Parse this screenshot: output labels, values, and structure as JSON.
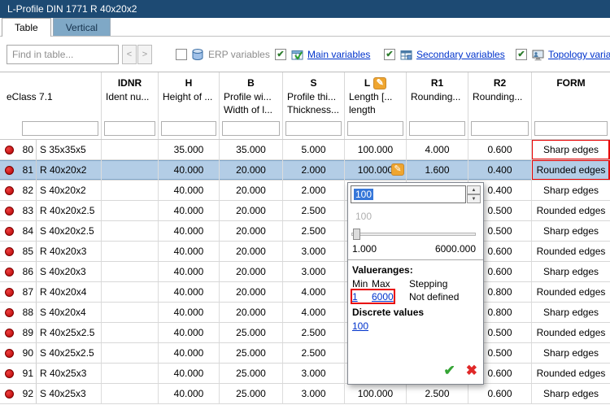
{
  "colors": {
    "titlebar": "#1d4a73",
    "selected_row": "#b3cde6",
    "link": "#0033cc",
    "status_dot": "#c41414",
    "annotation": "#e80000",
    "pencil_button": "#efa52f"
  },
  "icons": {
    "check": "✔",
    "pencil": "✎",
    "confirm": "✔",
    "cancel": "✖",
    "spinner_up": "▲",
    "spinner_down": "▼",
    "find_prev": "<",
    "find_next": ">"
  },
  "window": {
    "title": "L-Profile DIN 1771 R 40x20x2"
  },
  "tabs": {
    "table": "Table",
    "vertical": "Vertical"
  },
  "toolbar": {
    "find_placeholder": "Find in table...",
    "erp_label": "ERP variables",
    "main_label": "Main variables",
    "secondary_label": "Secondary variables",
    "topology_label": "Topology varia"
  },
  "table": {
    "eclass": "eClass 7.1",
    "columns": [
      {
        "code": "IDNR",
        "desc1": "Ident nu...",
        "desc2": ""
      },
      {
        "code": "H",
        "desc1": "Height of ...",
        "desc2": ""
      },
      {
        "code": "B",
        "desc1": "Profile wi...",
        "desc2": "Width of l..."
      },
      {
        "code": "S",
        "desc1": "Profile thi...",
        "desc2": "Thickness..."
      },
      {
        "code": "L",
        "desc1": "Length [...",
        "desc2": "length"
      },
      {
        "code": "R1",
        "desc1": "Rounding...",
        "desc2": ""
      },
      {
        "code": "R2",
        "desc1": "Rounding...",
        "desc2": ""
      },
      {
        "code": "FORM",
        "desc1": "",
        "desc2": ""
      }
    ],
    "rows": [
      {
        "num": "80",
        "name": "S 35x35x5",
        "idnr": "",
        "h": "35.000",
        "b": "35.000",
        "s": "5.000",
        "l": "100.000",
        "r1": "4.000",
        "r2": "0.600",
        "form": "Sharp edges",
        "form_boxed": true
      },
      {
        "num": "81",
        "name": "R 40x20x2",
        "idnr": "",
        "h": "40.000",
        "b": "20.000",
        "s": "2.000",
        "l": "100.000",
        "r1": "1.600",
        "r2": "0.400",
        "form": "Rounded edges",
        "selected": true,
        "editing": true,
        "form_boxed": true
      },
      {
        "num": "82",
        "name": "S 40x20x2",
        "idnr": "",
        "h": "40.000",
        "b": "20.000",
        "s": "2.000",
        "l": "",
        "r1": "",
        "r2": "0.400",
        "form": "Sharp edges"
      },
      {
        "num": "83",
        "name": "R 40x20x2.5",
        "idnr": "",
        "h": "40.000",
        "b": "20.000",
        "s": "2.500",
        "l": "",
        "r1": "",
        "r2": "0.500",
        "form": "Rounded edges"
      },
      {
        "num": "84",
        "name": "S 40x20x2.5",
        "idnr": "",
        "h": "40.000",
        "b": "20.000",
        "s": "2.500",
        "l": "",
        "r1": "",
        "r2": "0.500",
        "form": "Sharp edges"
      },
      {
        "num": "85",
        "name": "R 40x20x3",
        "idnr": "",
        "h": "40.000",
        "b": "20.000",
        "s": "3.000",
        "l": "",
        "r1": "",
        "r2": "0.600",
        "form": "Rounded edges"
      },
      {
        "num": "86",
        "name": "S 40x20x3",
        "idnr": "",
        "h": "40.000",
        "b": "20.000",
        "s": "3.000",
        "l": "",
        "r1": "",
        "r2": "0.600",
        "form": "Sharp edges"
      },
      {
        "num": "87",
        "name": "R 40x20x4",
        "idnr": "",
        "h": "40.000",
        "b": "20.000",
        "s": "4.000",
        "l": "",
        "r1": "",
        "r2": "0.800",
        "form": "Rounded edges"
      },
      {
        "num": "88",
        "name": "S 40x20x4",
        "idnr": "",
        "h": "40.000",
        "b": "20.000",
        "s": "4.000",
        "l": "",
        "r1": "",
        "r2": "0.800",
        "form": "Sharp edges"
      },
      {
        "num": "89",
        "name": "R 40x25x2.5",
        "idnr": "",
        "h": "40.000",
        "b": "25.000",
        "s": "2.500",
        "l": "",
        "r1": "",
        "r2": "0.500",
        "form": "Rounded edges"
      },
      {
        "num": "90",
        "name": "S 40x25x2.5",
        "idnr": "",
        "h": "40.000",
        "b": "25.000",
        "s": "2.500",
        "l": "",
        "r1": "",
        "r2": "0.500",
        "form": "Sharp edges"
      },
      {
        "num": "91",
        "name": "R 40x25x3",
        "idnr": "",
        "h": "40.000",
        "b": "25.000",
        "s": "3.000",
        "l": "",
        "r1": "",
        "r2": "0.600",
        "form": "Rounded edges"
      },
      {
        "num": "92",
        "name": "S 40x25x3",
        "idnr": "",
        "h": "40.000",
        "b": "25.000",
        "s": "3.000",
        "l": "100.000",
        "r1": "2.500",
        "r2": "0.600",
        "form": "Sharp edges"
      }
    ]
  },
  "popup": {
    "value": "100",
    "ghost_value": "100",
    "slider_min": "1.000",
    "slider_max": "6000.000",
    "valueranges_title": "Valueranges:",
    "min_header": "Min",
    "max_header": "Max",
    "stepping_header": "Stepping",
    "min_value": "1",
    "max_value": "6000",
    "stepping_value": "Not defined",
    "discrete_title": "Discrete values",
    "discrete_value": "100"
  }
}
